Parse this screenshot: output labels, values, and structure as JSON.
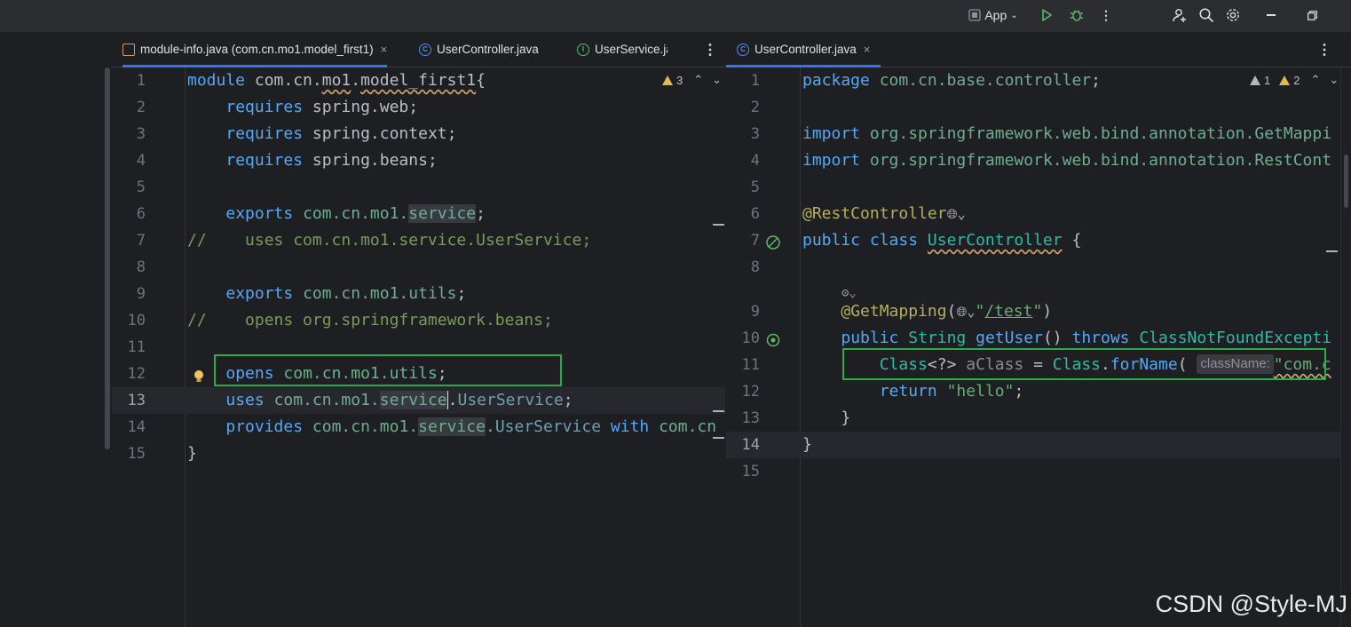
{
  "toolbar": {
    "run_config": "App"
  },
  "left_pane": {
    "tabs": [
      {
        "label": "module-info.java (com.cn.mo1.model_first1)",
        "close": "×"
      },
      {
        "label": "UserController.java"
      },
      {
        "label": "UserService.java"
      }
    ],
    "warnings": "3",
    "line_numbers": [
      "1",
      "2",
      "3",
      "4",
      "5",
      "6",
      "7",
      "8",
      "9",
      "10",
      "11",
      "12",
      "13",
      "14",
      "15"
    ]
  },
  "right_pane": {
    "tabs": [
      {
        "label": "UserController.java",
        "close": "×"
      }
    ],
    "warnings": "1",
    "weak_warnings": "2",
    "line_numbers": [
      "1",
      "2",
      "3",
      "4",
      "5",
      "6",
      "7",
      "8",
      "9",
      "10",
      "11",
      "12",
      "13",
      "14",
      "15"
    ],
    "param_hint": "className:"
  },
  "watermark": "CSDN @Style-MJ",
  "colors": {
    "accent": "#3574f0",
    "highlight_box": "#2eaa4c",
    "background": "#1e1f22"
  }
}
